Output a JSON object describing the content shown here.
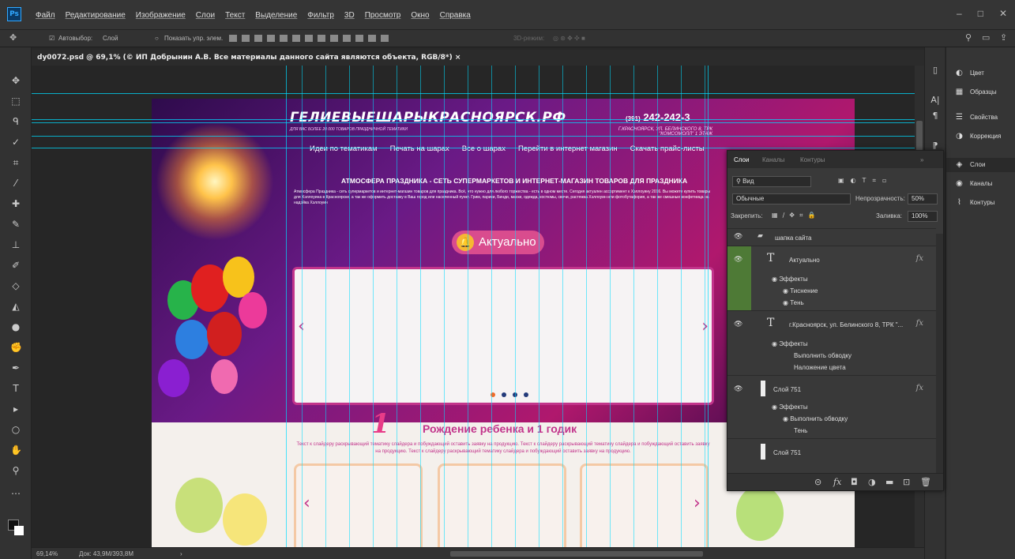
{
  "app": {
    "logo": "Ps"
  },
  "menu": [
    "Файл",
    "Редактирование",
    "Изображение",
    "Слои",
    "Текст",
    "Выделение",
    "Фильтр",
    "3D",
    "Просмотр",
    "Окно",
    "Справка"
  ],
  "window_controls": [
    "–",
    "□",
    "✕"
  ],
  "options": {
    "autoselect_label": "Автовыбор:",
    "autoselect_value": "Слой",
    "show_controls_label": "Показать упр. элем.",
    "mode_3d": "3D-режим:"
  },
  "document_tab": {
    "title": "dy0072.psd @ 69,1% (© ИП Добрынин А.В. Все материалы данного сайта являются объекта, RGB/8*)"
  },
  "tab_close": "×",
  "tools": [
    {
      "name": "move-tool-icon",
      "glyph": "✥"
    },
    {
      "name": "marquee-tool-icon",
      "glyph": "⬚"
    },
    {
      "name": "lasso-tool-icon",
      "glyph": "ᑫ"
    },
    {
      "name": "quick-select-tool-icon",
      "glyph": "✓"
    },
    {
      "name": "crop-tool-icon",
      "glyph": "⌗"
    },
    {
      "name": "eyedropper-tool-icon",
      "glyph": "⁄"
    },
    {
      "name": "healing-tool-icon",
      "glyph": "✚"
    },
    {
      "name": "brush-tool-icon",
      "glyph": "✎"
    },
    {
      "name": "stamp-tool-icon",
      "glyph": "⊥"
    },
    {
      "name": "history-brush-tool-icon",
      "glyph": "✐"
    },
    {
      "name": "eraser-tool-icon",
      "glyph": "◇"
    },
    {
      "name": "gradient-tool-icon",
      "glyph": "◭"
    },
    {
      "name": "blur-tool-icon",
      "glyph": "●"
    },
    {
      "name": "dodge-tool-icon",
      "glyph": "✊"
    },
    {
      "name": "pen-tool-icon",
      "glyph": "✒"
    },
    {
      "name": "type-tool-icon",
      "glyph": "T"
    },
    {
      "name": "path-select-tool-icon",
      "glyph": "▸"
    },
    {
      "name": "shape-tool-icon",
      "glyph": "○"
    },
    {
      "name": "hand-tool-icon",
      "glyph": "✋"
    },
    {
      "name": "zoom-tool-icon",
      "glyph": "⚲"
    },
    {
      "name": "more-tools-icon",
      "glyph": "…"
    }
  ],
  "site": {
    "logo": "ГЕЛИЕВЫЕШАРЫКРАСНОЯРСК.РФ",
    "logo_sub": "ДЛЯ ВАС БОЛЕЕ 20 000 ТОВАРОВ ПРАЗДНИЧНОЙ ТЕМАТИКИ",
    "phone": "242-242-3",
    "phone_code": "(391)",
    "address": "Г.КРАСНОЯРСК, УЛ. БЕЛИНСКОГО 8, ТРК \"КОМСОМОЛЛ\" 1 ЭТАЖ",
    "nav": [
      "Идеи по тематикам",
      "Печать на шарах",
      "Все о шарах",
      "Перейти в интернет магазин",
      "Скачать прайс-листы"
    ],
    "headline": "АТМОСФЕРА ПРАЗДНИКА - СЕТЬ СУПЕРМАРКЕТОВ И ИНТЕРНЕТ-МАГАЗИН ТОВАРОВ ДЛЯ ПРАЗДНИКА",
    "paragraph": "Атмосфера Праздника - сеть супермаркетов и интернет-магазин товаров для праздника. Всё, что нужно для любого торжества - есть в одном месте. Сегодня актуален ассортимент к Хэллоуину 2016. Вы можете купить товары для Хэллоуина в Красноярске, а так же оформить доставку в Ваш город или населенный пункт. Грим, парики, Бинди, маски, одежда, костюмы, свечи, растяжка Хэллоуин или фотобутафория, а так же смешные конфетница на надэйка Хэллоуин",
    "aktualno": "Актуально",
    "bell": "🔔",
    "arrow_left": "‹",
    "arrow_right": "›",
    "birth_one": "1",
    "birth_title": "Рождение ребенка и 1 годик",
    "birth_text": "Текст к слайдеру раскрывающий тематику слайдера и побуждающий оставить заявку на продукцию. Текст к слайдеру раскрывающий тематику слайдера и побуждающий оставить заявку на продукцию. Текст к слайдеру раскрывающий тематику слайдера и побуждающий оставить заявку на продукцию."
  },
  "status": {
    "zoom": "69,14%",
    "doc": "Док: 43,9M/393,8M",
    "arrow": "›"
  },
  "right_strip": [
    "▯",
    "A|",
    "¶",
    "⁋"
  ],
  "right_panels": [
    {
      "name": "color-panel",
      "icon": "◐",
      "label": "Цвет"
    },
    {
      "name": "swatches-panel",
      "icon": "▦",
      "label": "Образцы"
    },
    {
      "name": "properties-panel",
      "icon": "☰",
      "label": "Свойства"
    },
    {
      "name": "adjustments-panel",
      "icon": "◑",
      "label": "Коррекция"
    },
    {
      "name": "layers-panel",
      "icon": "◈",
      "label": "Слои",
      "selected": true
    },
    {
      "name": "channels-panel",
      "icon": "◉",
      "label": "Каналы"
    },
    {
      "name": "paths-panel",
      "icon": "⌇",
      "label": "Контуры"
    }
  ],
  "layers_panel": {
    "tabs": [
      "Слои",
      "Каналы",
      "Контуры"
    ],
    "tab_menu": "»",
    "filter_label": "Вид",
    "filter_icons": [
      "▣",
      "◐",
      "T",
      "⌗",
      "▫"
    ],
    "blend_mode": "Обычные",
    "opacity_label": "Непрозрачность:",
    "opacity_value": "50%",
    "lock_label": "Закрепить:",
    "lock_icons": [
      "▦",
      "∕",
      "✥",
      "⌗",
      "🔒"
    ],
    "fill_label": "Заливка:",
    "fill_value": "100%",
    "eye_icon": "👁",
    "folder_icon": "▰",
    "type_icon": "T",
    "fx_label": "fx",
    "group": "шапка сайта",
    "layer1": "Актуально",
    "l1_effects": "Эффекты",
    "l1_e1": "Тиснение",
    "l1_e2": "Тень",
    "layer2": "г.Красноярск, ул. Белинского 8,  ТРК \"...",
    "l2_effects": "Эффекты",
    "l2_e1": "Выполнить обводку",
    "l2_e2": "Наложение цвета",
    "layer3": "Слой 751",
    "l3_effects": "Эффекты",
    "l3_e1": "Выполнить обводку",
    "l3_e2": "Тень",
    "layer4": "Слой 751",
    "footer_icons": [
      "⊝",
      "fx",
      "◘",
      "◑",
      "▬",
      "⊡",
      "🗑"
    ]
  },
  "colors": {
    "guide": "#00dcff",
    "accent": "#c2348b",
    "ps_blue": "#31a8ff"
  }
}
